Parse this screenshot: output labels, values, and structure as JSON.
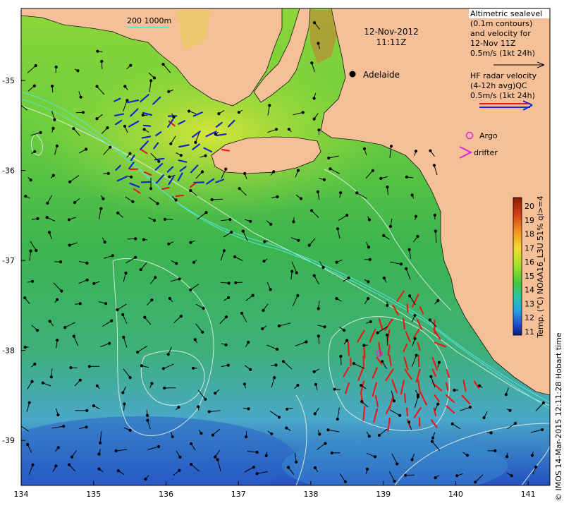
{
  "map": {
    "lon_ticks": [
      "134",
      "135",
      "136",
      "137",
      "138",
      "139",
      "140",
      "141"
    ],
    "lat_ticks": [
      "-35",
      "-36",
      "-37",
      "-38",
      "-39"
    ],
    "lon_range": [
      134,
      141.3
    ],
    "lat_range": [
      -39.5,
      -34.2
    ]
  },
  "scale_bar": {
    "label": "200 1000m"
  },
  "datetime": {
    "date": "12-Nov-2012",
    "time": "11:11Z"
  },
  "place": {
    "name": "Adelaide",
    "lon": 138.6,
    "lat": -34.93
  },
  "legend": {
    "altimetric": [
      "Altimetric sealevel",
      "(0.1m contours)",
      "and velocity for",
      "12-Nov 11Z",
      "0.5m/s (1kt 24h)"
    ],
    "hf_radar": [
      "HF radar velocity",
      "(4-12h avg)QC",
      "0.5m/s (1kt 24h)"
    ],
    "argo_label": "Argo",
    "drifter_label": "drifter"
  },
  "colorbar": {
    "ticks": [
      "20",
      "19",
      "18",
      "17",
      "16",
      "15",
      "14",
      "13",
      "12",
      "11"
    ],
    "title": "Temp. (°C) NOAA16_L3U 51% ql>=4",
    "colors": [
      "#8b1a00",
      "#c8321e",
      "#f06e1e",
      "#f8b428",
      "#f2e632",
      "#b4e628",
      "#5ac828",
      "#28c89b",
      "#28aade",
      "#1e6ee6",
      "#1432a0"
    ]
  },
  "credit": "© IMOS 14-Mar-2015 12:11:28 Hobart time",
  "argo_float": {
    "lon": 138.93,
    "lat": -38.02
  },
  "colors": {
    "land": "#f5c097",
    "radar_red": "#e81a1a",
    "radar_blue": "#1428c8",
    "argo": "#d22adc",
    "contour": "#e6f0e6"
  }
}
